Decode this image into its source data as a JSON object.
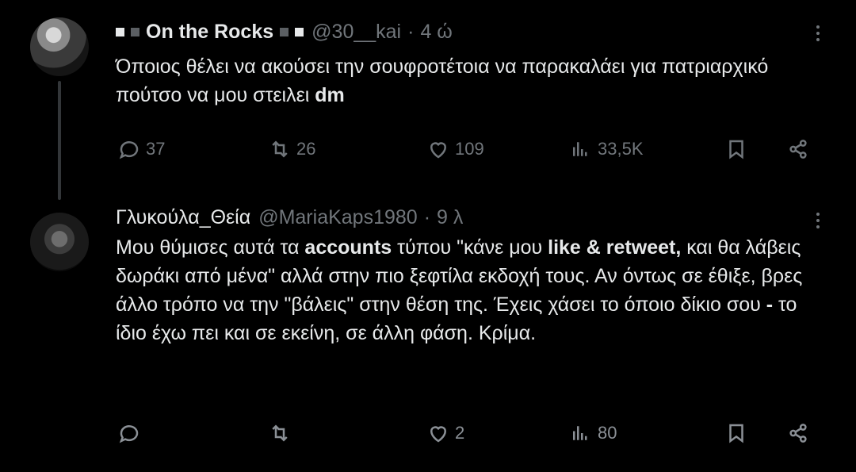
{
  "posts": [
    {
      "name": "On the Rocks",
      "handle": "@30__kai",
      "time": "4 ώ",
      "body_parts": [
        {
          "text": "Όποιος θέλει να ακούσει την σουφροτέτοια να παρακαλάει για πατριαρχικό πούτσο να μου στειλει ",
          "bold": false
        },
        {
          "text": "dm",
          "bold": true
        }
      ],
      "stats": {
        "replies": "37",
        "reposts": "26",
        "likes": "109",
        "views": "33,5K"
      }
    },
    {
      "name": "Γλυκούλα_Θεία",
      "handle": "@MariaKaps1980",
      "time": "9 λ",
      "body_parts": [
        {
          "text": "Μου θύμισες αυτά τα ",
          "bold": false
        },
        {
          "text": "accounts",
          "bold": true
        },
        {
          "text": " τύπου \"κάνε μου ",
          "bold": false
        },
        {
          "text": "like & retweet,",
          "bold": true
        },
        {
          "text": " και θα λάβεις δωράκι από μένα\" αλλά στην πιο ξεφτίλα εκδοχή τους. Αν όντως σε έθιξε, βρες άλλο τρόπο να την \"βάλεις\" στην θέση της. Έχεις χάσει το όποιο δίκιο σου ",
          "bold": false
        },
        {
          "text": "-",
          "bold": true
        },
        {
          "text": " το ίδιο έχω πει και σε εκείνη, σε άλλη φάση. Κρίμα.",
          "bold": false
        }
      ],
      "stats": {
        "replies": "",
        "reposts": "",
        "likes": "2",
        "views": "80"
      }
    }
  ],
  "colors": {
    "background": "#000000",
    "text": "#e7e9ea",
    "muted": "#71767b",
    "thread_line": "#333639"
  },
  "icons": [
    "reply-icon",
    "repost-icon",
    "like-icon",
    "views-icon",
    "bookmark-icon",
    "share-icon",
    "more-icon"
  ]
}
